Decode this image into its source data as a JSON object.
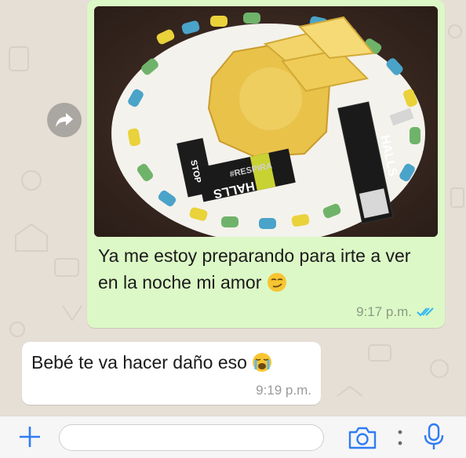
{
  "chat": {
    "outgoing": {
      "text": "Ya me estoy preparando para irte a ver en la noche mi amor",
      "time": "9:17 p.m.",
      "emoji": "smirking-face",
      "status": "read",
      "photo": {
        "candy_brand_left": "HALLS",
        "candy_brand_left_sub": "STOP",
        "candy_brand_left_tag": "#RESPIRA",
        "candy_brand_right": "HALLS"
      }
    },
    "incoming": {
      "text": "Bebé te va hacer daño eso",
      "time": "9:19 p.m.",
      "emoji": "loudly-crying-face"
    }
  },
  "input_bar": {
    "placeholder": "",
    "plus_icon": "plus-icon",
    "camera_icon": "camera-icon",
    "mic_icon": "microphone-icon"
  },
  "colors": {
    "outgoing_bubble": "#dcf8c6",
    "incoming_bubble": "#ffffff",
    "accent": "#2f7cf6",
    "read_ticks": "#34b7f1",
    "wallpaper": "#e6dfd6"
  }
}
